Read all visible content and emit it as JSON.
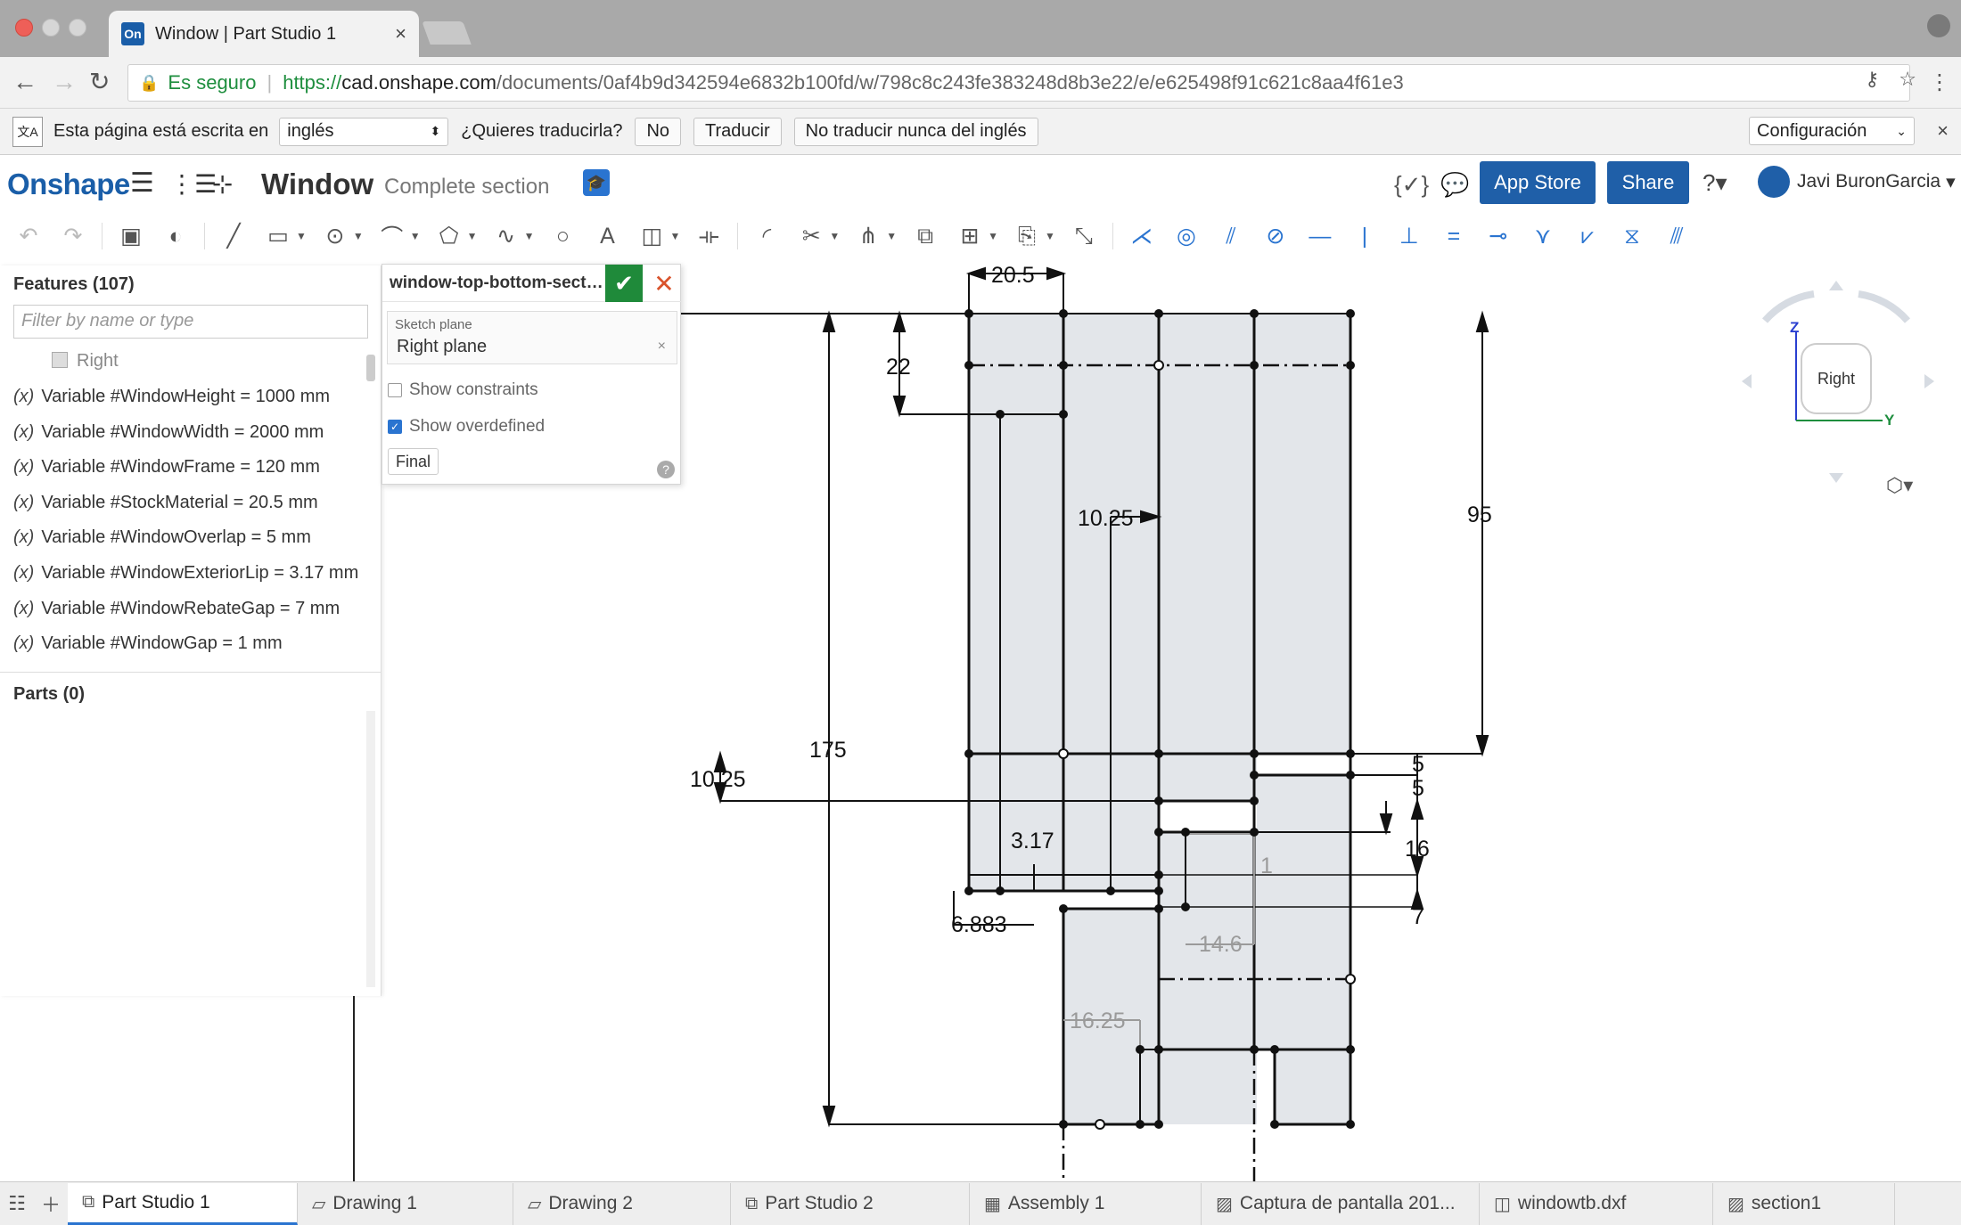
{
  "browser": {
    "tab_title": "Window | Part Studio 1",
    "favicon": "On",
    "url": {
      "secure_label": "Es seguro",
      "scheme": "https://",
      "host": "cad.onshape.com",
      "path": "/documents/0af4b9d342594e6832b100fd/w/798c8c243fe383248d8b3e22/e/e625498f91c621c8aa4f61e3"
    }
  },
  "translate_bar": {
    "prompt": "Esta página está escrita en",
    "language": "inglés",
    "question": "¿Quieres traducirla?",
    "no": "No",
    "translate": "Traducir",
    "never": "No traducir nunca del inglés",
    "settings": "Configuración"
  },
  "app": {
    "logo": "Onshape",
    "doc_title": "Window",
    "doc_subtitle": "Complete section",
    "app_store": "App Store",
    "share": "Share",
    "user_name": "Javi BuronGarcia",
    "accent": "#1f5fa8"
  },
  "features": {
    "title": "Features (107)",
    "filter_placeholder": "Filter by name or type",
    "first_item": "Right",
    "variables": [
      "Variable #WindowHeight = 1000 mm",
      "Variable #WindowWidth = 2000 mm",
      "Variable #WindowFrame = 120 mm",
      "Variable #StockMaterial = 20.5 mm",
      "Variable #WindowOverlap = 5 mm",
      "Variable #WindowExteriorLip = 3.17 mm",
      "Variable #WindowRebateGap = 7 mm",
      "Variable #WindowGap = 1 mm"
    ],
    "var_symbol": "(x)",
    "parts": "Parts (0)"
  },
  "sketch_dialog": {
    "name": "window-top-bottom-secti...",
    "plane_label": "Sketch plane",
    "plane_value": "Right plane",
    "show_constraints": "Show constraints",
    "show_overdefined": "Show overdefined",
    "show_constraints_checked": false,
    "show_overdefined_checked": true,
    "final": "Final"
  },
  "dimensions": {
    "d20_5": "20.5",
    "d22": "22",
    "d10_25a": "10.25",
    "d95": "95",
    "d175": "175",
    "d10_25b": "10.25",
    "d5a": "5",
    "d5b": "5",
    "d3_17": "3.17",
    "d16": "16",
    "d1": "1",
    "d6_883": "6.883",
    "d7": "7",
    "d14_6": "14.6",
    "d16_25": "16.25"
  },
  "viewcube": {
    "face": "Right",
    "axis_z": "Z",
    "axis_y": "Y"
  },
  "bottom_tabs": [
    "Part Studio 1",
    "Drawing 1",
    "Drawing 2",
    "Part Studio 2",
    "Assembly 1",
    "Captura de pantalla 201...",
    "windowtb.dxf",
    "section1"
  ]
}
